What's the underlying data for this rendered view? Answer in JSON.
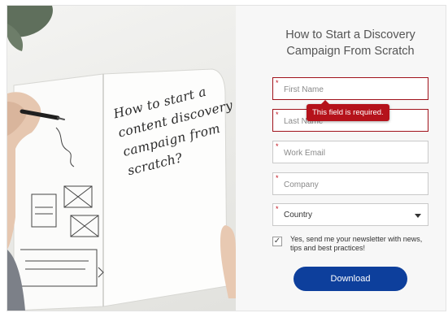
{
  "hero": {
    "note_lines": [
      "How to start a",
      "content discovery",
      "campaign from",
      "scratch?"
    ]
  },
  "form": {
    "title_lines": [
      "How to Start a Discovery",
      "Campaign From Scratch"
    ],
    "required_mark": "*",
    "fields": {
      "first_name": {
        "placeholder": "First Name"
      },
      "last_name": {
        "placeholder": "Last Name"
      },
      "work_email": {
        "placeholder": "Work Email"
      },
      "company": {
        "placeholder": "Company"
      },
      "country": {
        "selected": "Country"
      }
    },
    "error_tooltip": "This field is required.",
    "optin": {
      "checked_glyph": "✓",
      "text": "Yes, send me your newsletter with news, tips and best practices!"
    },
    "download_label": "Download"
  },
  "colors": {
    "accent_button": "#0d3f9c",
    "error": "#b5121b",
    "invalid_border": "#a0121b"
  }
}
